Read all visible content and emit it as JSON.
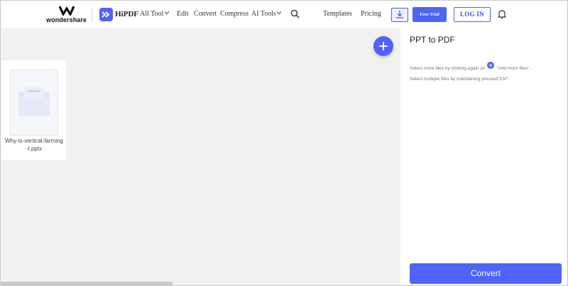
{
  "header": {
    "brand": "wondershare",
    "product": "HiPDF",
    "nav": [
      "All Tool",
      "Edit",
      "Convert",
      "Compress",
      "AI Tools"
    ],
    "templates": "Templates",
    "pricing": "Pricing",
    "free_trial": "Free Trial",
    "login": "LOG IN"
  },
  "workspace": {
    "file": {
      "name": "Why-is-vertical-farming-t.pptx",
      "type": "pptx"
    }
  },
  "panel": {
    "title": "PPT to PDF",
    "hint1_before": "Select more files by clicking again on",
    "hint1_after": "\"Add more files\".",
    "hint2": "Select multiple files by maintaining pressed\"Ctrl\".",
    "convert": "Convert"
  },
  "colors": {
    "accent": "#4f63f6",
    "workspace_bg": "#f1f1f1"
  }
}
